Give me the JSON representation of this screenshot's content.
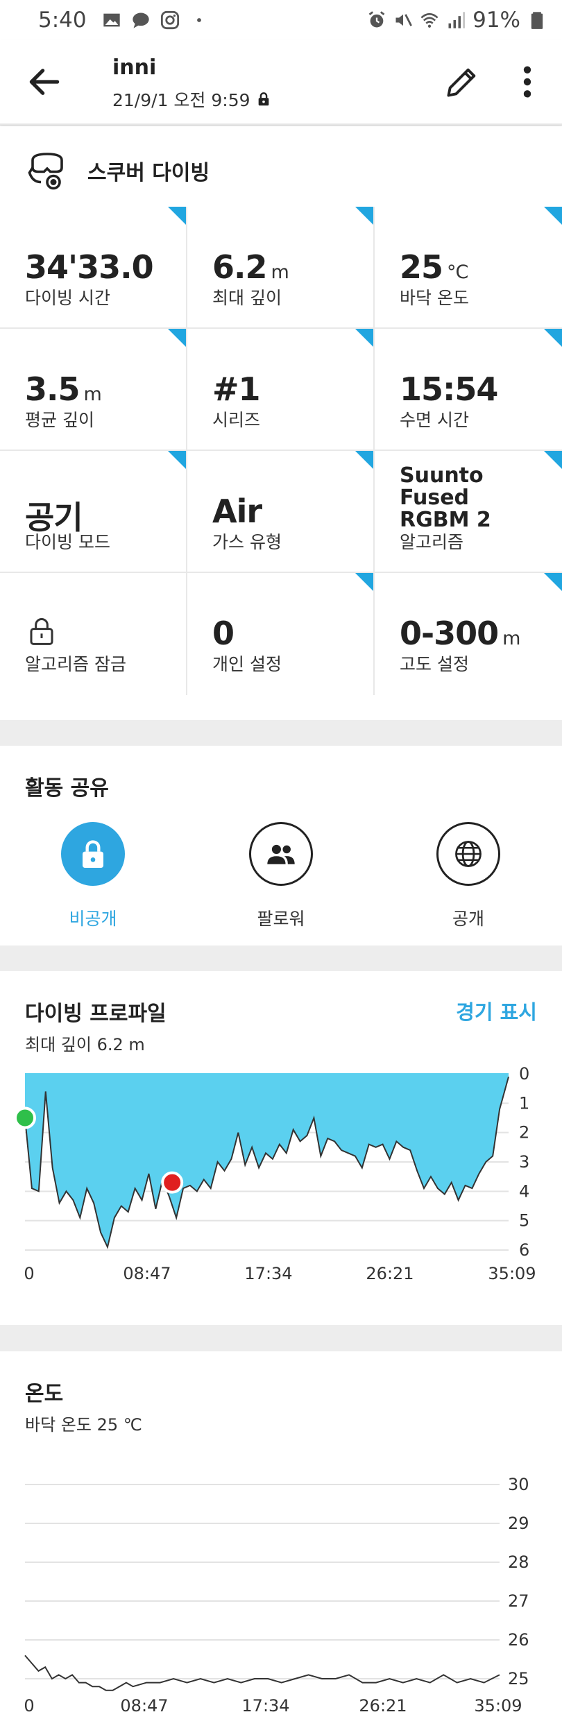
{
  "status_bar": {
    "time": "5:40",
    "battery": "91%",
    "left_icons": [
      "gallery-icon",
      "chat-bubble-icon",
      "instagram-icon",
      "dot-icon"
    ],
    "right_icons": [
      "alarm-icon",
      "mute-icon",
      "wifi-icon",
      "signal-icon",
      "battery-icon"
    ]
  },
  "header": {
    "title": "inni",
    "subtitle": "21/9/1 오전 9:59",
    "icons": [
      "back-arrow-icon",
      "lock-icon",
      "edit-pencil-icon",
      "more-vert-icon"
    ]
  },
  "sport": {
    "label": "스쿠버 다이빙",
    "icon": "scuba-icon"
  },
  "stats": [
    {
      "value": "34'33.0",
      "unit": "",
      "label": "다이빙 시간",
      "corner": true
    },
    {
      "value": "6.2",
      "unit": "m",
      "label": "최대 깊이",
      "corner": true
    },
    {
      "value": "25",
      "unit": "°C",
      "label": "바닥 온도",
      "corner": true
    },
    {
      "value": "3.5",
      "unit": "m",
      "label": "평균 깊이",
      "corner": true
    },
    {
      "value": "#1",
      "unit": "",
      "label": "시리즈",
      "corner": true
    },
    {
      "value": "15:54",
      "unit": "",
      "label": "수면 시간",
      "corner": true
    },
    {
      "value": "공기",
      "unit": "",
      "label": "다이빙 모드",
      "corner": true
    },
    {
      "value": "Air",
      "unit": "",
      "label": "가스 유형",
      "corner": true
    },
    {
      "value": "Suunto Fused RGBM 2",
      "unit": "",
      "label": "알고리즘",
      "corner": true,
      "small": true
    },
    {
      "value": "",
      "unit": "",
      "label": "알고리즘 잠금",
      "corner": false,
      "icon": "lock-outline-icon"
    },
    {
      "value": "0",
      "unit": "",
      "label": "개인 설정",
      "corner": true
    },
    {
      "value": "0-300",
      "unit": "m",
      "label": "고도 설정",
      "corner": true
    }
  ],
  "share": {
    "title": "활동 공유",
    "options": [
      {
        "label": "비공개",
        "icon": "lock-icon",
        "active": true
      },
      {
        "label": "팔로워",
        "icon": "people-icon",
        "active": false
      },
      {
        "label": "공개",
        "icon": "globe-icon",
        "active": false
      }
    ]
  },
  "dive_profile": {
    "title": "다이빙 프로파일",
    "link": "경기 표시",
    "subtitle": "최대 깊이 6.2 m",
    "chart_data": {
      "type": "area",
      "x_tick_labels": [
        "0",
        "08:47",
        "17:34",
        "26:21",
        "35:09"
      ],
      "y_tick_labels": [
        "0",
        "1",
        "2",
        "3",
        "4",
        "5",
        "6"
      ],
      "ylim": [
        0,
        6
      ],
      "y_inverted": true,
      "fill_color": "#5bd0ef",
      "line_color": "#333333",
      "series": [
        {
          "x_minutes": [
            0,
            0.5,
            1,
            1.5,
            2,
            2.5,
            3,
            3.5,
            4,
            4.5,
            5,
            5.5,
            6,
            6.5,
            7,
            7.5,
            8,
            8.5,
            9,
            9.5,
            10,
            10.5,
            11,
            11.5,
            12,
            12.5,
            13,
            13.5,
            14,
            14.5,
            15,
            15.5,
            16,
            16.5,
            17,
            17.5,
            18,
            18.5,
            19,
            19.5,
            20,
            20.5,
            21,
            21.5,
            22,
            22.5,
            23,
            23.5,
            24,
            24.5,
            25,
            25.5,
            26,
            26.5,
            27,
            27.5,
            28,
            28.5,
            29,
            29.5,
            30,
            30.5,
            31,
            31.5,
            32,
            32.5,
            33,
            33.5,
            34,
            34.5,
            35.15
          ],
          "depth_m": [
            1.5,
            3.9,
            4.0,
            0.6,
            3.2,
            4.4,
            4.0,
            4.3,
            4.9,
            3.9,
            4.4,
            5.4,
            5.9,
            4.9,
            4.5,
            4.7,
            3.9,
            4.3,
            3.4,
            4.6,
            3.6,
            4.2,
            4.9,
            3.9,
            3.8,
            4.0,
            3.6,
            3.9,
            3.0,
            3.3,
            2.9,
            2.0,
            3.1,
            2.5,
            3.2,
            2.7,
            2.9,
            2.4,
            2.7,
            1.9,
            2.3,
            2.1,
            1.5,
            2.8,
            2.2,
            2.3,
            2.6,
            2.7,
            2.8,
            3.2,
            2.4,
            2.5,
            2.4,
            2.9,
            2.3,
            2.5,
            2.6,
            3.3,
            3.9,
            3.5,
            3.9,
            4.1,
            3.7,
            4.3,
            3.8,
            3.9,
            3.4,
            3.0,
            2.8,
            1.2,
            0.1
          ]
        }
      ],
      "markers": [
        {
          "name": "start",
          "x_minutes": 0,
          "depth_m": 1.5,
          "color": "#2fbf4a"
        },
        {
          "name": "selected",
          "x_minutes": 10.7,
          "depth_m": 3.7,
          "color": "#e02020"
        }
      ]
    }
  },
  "temperature": {
    "title": "온도",
    "subtitle": "바닥 온도 25 ℃",
    "chart_data": {
      "type": "line",
      "x_tick_labels": [
        "0",
        "08:47",
        "17:34",
        "26:21",
        "35:09"
      ],
      "y_tick_labels": [
        "30",
        "29",
        "28",
        "27",
        "26",
        "25"
      ],
      "ylim": [
        24.5,
        30
      ],
      "line_color": "#333333",
      "series": [
        {
          "x_minutes": [
            0,
            0.5,
            1,
            1.5,
            2,
            2.5,
            3,
            3.5,
            4,
            4.5,
            5,
            5.5,
            6,
            6.5,
            7,
            7.5,
            8,
            9,
            10,
            11,
            12,
            13,
            14,
            15,
            16,
            17,
            18,
            19,
            20,
            21,
            22,
            23,
            24,
            25,
            26,
            27,
            28,
            29,
            30,
            31,
            32,
            33,
            34,
            35.15
          ],
          "temp_c": [
            25.6,
            25.4,
            25.2,
            25.3,
            25.0,
            25.1,
            25.0,
            25.1,
            24.9,
            24.9,
            24.8,
            24.8,
            24.7,
            24.7,
            24.8,
            24.9,
            24.8,
            24.9,
            24.9,
            25.0,
            24.9,
            25.0,
            24.9,
            25.0,
            24.9,
            25.0,
            25.0,
            24.9,
            25.0,
            25.1,
            25.0,
            25.0,
            25.1,
            24.9,
            24.9,
            25.0,
            24.9,
            25.0,
            24.9,
            25.1,
            24.9,
            25.0,
            24.9,
            25.1
          ]
        }
      ]
    }
  }
}
